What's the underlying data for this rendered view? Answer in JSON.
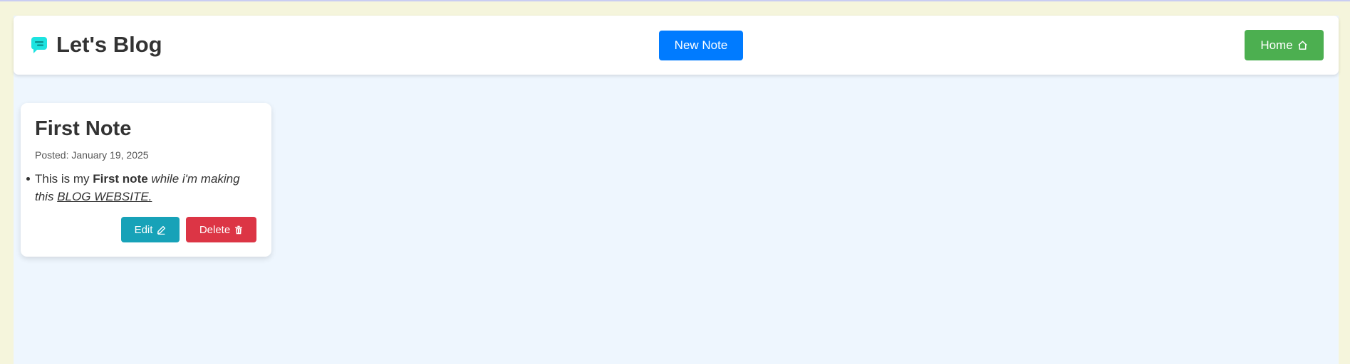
{
  "app": {
    "title": "Let's Blog",
    "logo_icon": "chat-bubble-icon",
    "brand_color": "#1de3e0"
  },
  "navbar": {
    "new_note_label": "New Note",
    "home_label": "Home",
    "home_icon": "home-icon"
  },
  "colors": {
    "new_note": "#007bff",
    "home": "#4caf50",
    "edit": "#17a2b8",
    "delete": "#dc3545"
  },
  "notes": [
    {
      "title": "First Note",
      "posted": "Posted: January 19, 2025",
      "content": {
        "plain": "This is my ",
        "bold": "First note",
        "italic": " while i'm making this ",
        "underline_italic": "BLOG WEBSITE."
      },
      "edit_label": "Edit",
      "edit_icon": "pencil-icon",
      "delete_label": "Delete",
      "delete_icon": "trash-icon"
    }
  ]
}
